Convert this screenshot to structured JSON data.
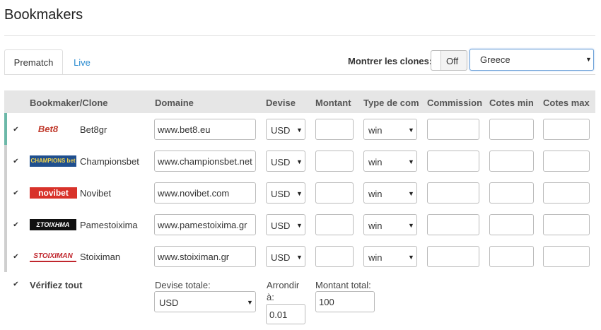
{
  "page": {
    "title": "Bookmakers"
  },
  "tabs": [
    {
      "label": "Prematch",
      "active": true
    },
    {
      "label": "Live",
      "active": false
    }
  ],
  "clones": {
    "label": "Montrer les clones:",
    "toggle": "Off"
  },
  "country": {
    "selected": "Greece"
  },
  "table": {
    "headers": [
      "Bookmaker/Clone",
      "Domaine",
      "Devise",
      "Montant",
      "Type de com",
      "Commission",
      "Cotes min",
      "Cotes max"
    ],
    "rows": [
      {
        "logo": "Bet8",
        "name": "Bet8gr",
        "domain": "www.bet8.eu",
        "currency": "USD",
        "type": "win",
        "checked": true,
        "bar": "#6cb8a8"
      },
      {
        "logo": "CHAMPIONS bet",
        "name": "Championsbet",
        "domain": "www.championsbet.net",
        "currency": "USD",
        "type": "win",
        "checked": true,
        "bar": "#cfcfcf"
      },
      {
        "logo": "novibet",
        "name": "Novibet",
        "domain": "www.novibet.com",
        "currency": "USD",
        "type": "win",
        "checked": true,
        "bar": "#cfcfcf"
      },
      {
        "logo": "ΣΤΟΙΧΗΜΑ",
        "name": "Pamestoixima",
        "domain": "www.pamestoixima.gr",
        "currency": "USD",
        "type": "win",
        "checked": true,
        "bar": "#cfcfcf"
      },
      {
        "logo": "STOIXIMAN",
        "name": "Stoiximan",
        "domain": "www.stoiximan.gr",
        "currency": "USD",
        "type": "win",
        "checked": true,
        "bar": "#cfcfcf"
      }
    ]
  },
  "footer": {
    "verify_all": "Vérifiez tout",
    "total_currency_label": "Devise totale:",
    "total_currency": "USD",
    "round_label_1": "Arrondir",
    "round_label_2": "à:",
    "round_value": "0.01",
    "total_amount_label": "Montant total:",
    "total_amount": "100"
  }
}
